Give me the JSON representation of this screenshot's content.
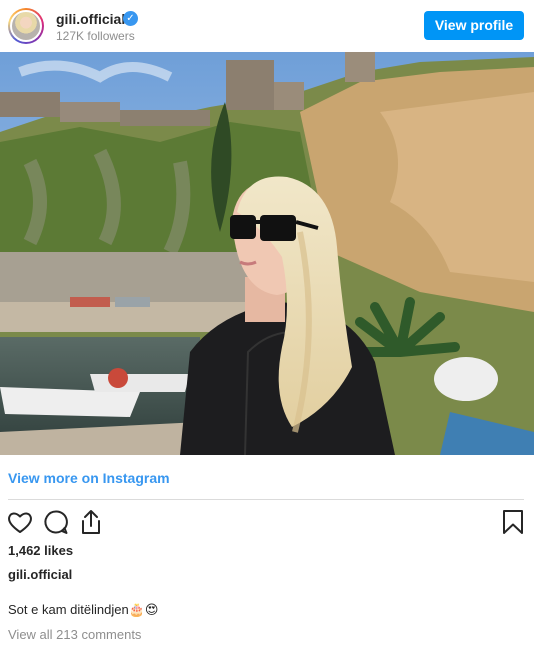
{
  "header": {
    "username": "gili.official",
    "followers": "127K followers",
    "view_profile_label": "View profile",
    "verified_glyph": "✓"
  },
  "post": {
    "image_alt": "Woman with long blonde hair and black sunglasses at a seaside harbor below rocky cliffs",
    "view_more_label": "View more on Instagram",
    "likes": "1,462 likes",
    "caption_username": "gili.official",
    "caption_text": "Sot e kam ditëlindjen🎂😍",
    "comments_link": "View all 213 comments"
  },
  "icons": {
    "like": "heart-icon",
    "comment": "comment-icon",
    "share": "share-icon",
    "save": "bookmark-icon",
    "verified": "verified-badge-icon"
  },
  "colors": {
    "accent": "#0095f6",
    "link": "#3897f0",
    "text": "#262626",
    "muted": "#8e8e8e",
    "divider": "#dbdbdb"
  }
}
